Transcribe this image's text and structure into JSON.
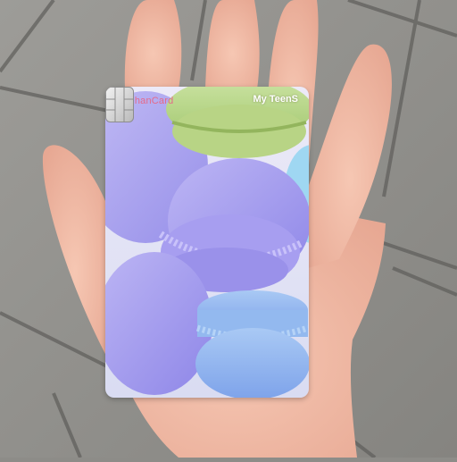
{
  "card": {
    "brand_text": "ShinhanCard",
    "product_name": "My TeenS"
  },
  "colors": {
    "pavement": "#8d8c88",
    "skin": "#f0b9a4",
    "macaron_purple": "#a79ff0",
    "macaron_blue": "#8fb4ee",
    "macaron_green": "#b6d58a",
    "brand_text": "#e56a8a"
  }
}
